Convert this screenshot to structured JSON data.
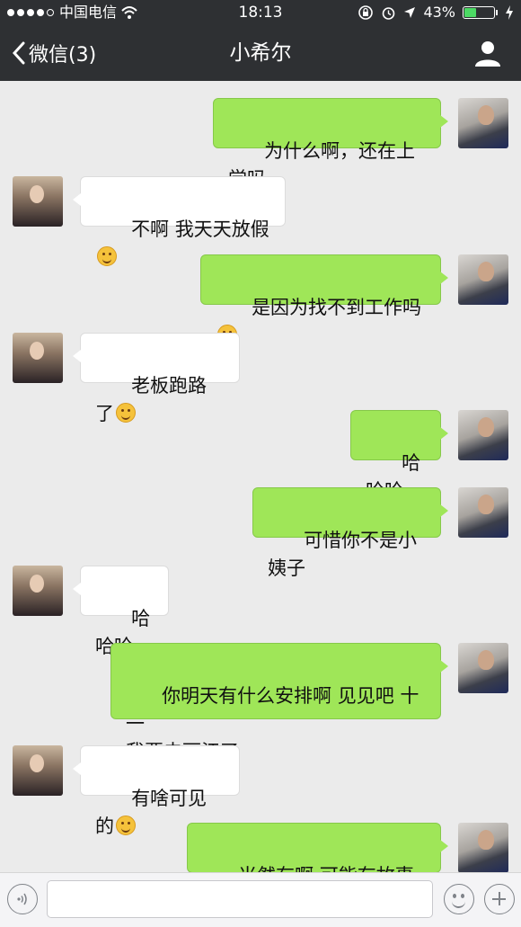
{
  "status_bar": {
    "carrier": "中国电信",
    "time": "18:13",
    "battery": "43%",
    "battery_level": 0.43,
    "icons": [
      "signal-dots-icon",
      "wifi-icon",
      "rotation-lock-icon",
      "alarm-icon",
      "location-icon",
      "charging-icon"
    ]
  },
  "nav": {
    "back_label": "微信(3)",
    "title": "小希尔",
    "back_icon": "chevron-left-icon",
    "profile_icon": "person-icon"
  },
  "messages": [
    {
      "from": "me",
      "text": "为什么啊，还在上学吗",
      "emoji": ""
    },
    {
      "from": "her",
      "text": "不啊 我天天放假",
      "emoji": "thinking-emoji"
    },
    {
      "from": "me",
      "text": "是因为找不到工作吗",
      "emoji": "thinking-emoji"
    },
    {
      "from": "her",
      "text": "老板跑路了",
      "emoji": "smile-emoji"
    },
    {
      "from": "me",
      "text": "哈哈哈",
      "emoji": ""
    },
    {
      "from": "me",
      "text": "可惜你不是小姨子",
      "emoji": ""
    },
    {
      "from": "her",
      "text": "哈哈哈",
      "emoji": ""
    },
    {
      "from": "me",
      "text": "你明天有什么安排啊 见见吧 十一\n我要去丽江了",
      "emoji": ""
    },
    {
      "from": "her",
      "text": "有啥可见的",
      "emoji": "smile-emoji"
    },
    {
      "from": "me",
      "text": "当然有啊 可能有故事发生",
      "emoji": ""
    }
  ],
  "input_bar": {
    "voice_icon": "voice-icon",
    "emoji_icon": "emoji-icon",
    "plus_icon": "plus-icon",
    "input_value": ""
  },
  "colors": {
    "nav_bg": "#2e3033",
    "chat_bg": "#ebebeb",
    "my_bubble": "#9fe658",
    "her_bubble": "#ffffff"
  }
}
